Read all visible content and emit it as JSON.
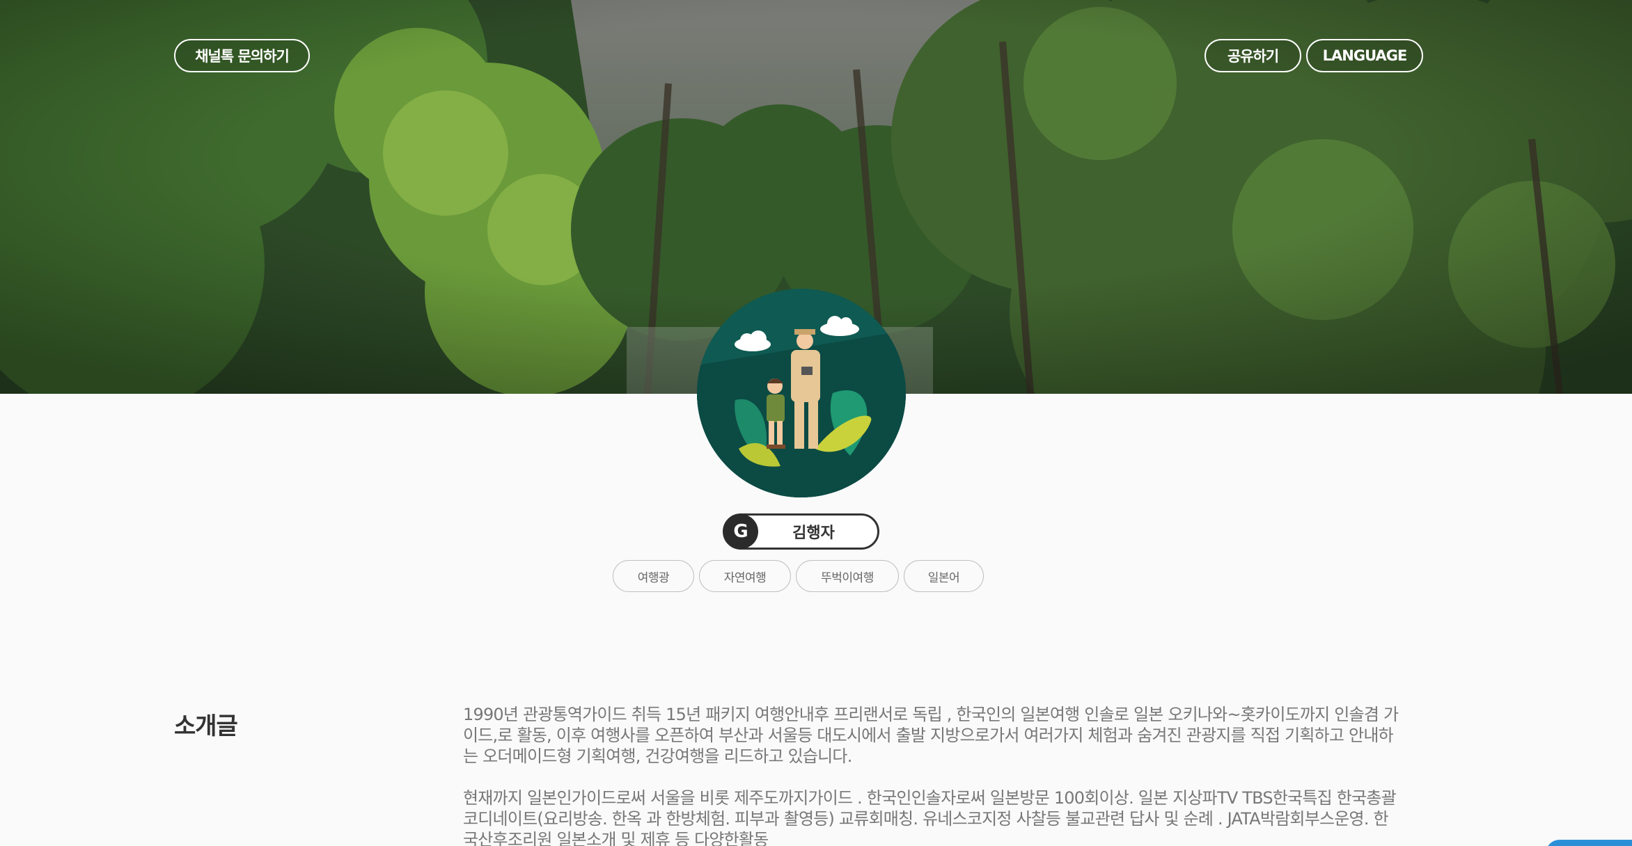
{
  "header": {
    "kakao_button": "채널톡 문의하기",
    "share_button": "공유하기",
    "language_button": "LANGUAGE"
  },
  "profile": {
    "badge_letter": "G",
    "name": "김행자",
    "tags": [
      "여행광",
      "자연여행",
      "뚜벅이여행",
      "일본어"
    ]
  },
  "intro": {
    "title": "소개글",
    "paragraphs": [
      "1990년 관광통역가이드 취득 15년 패키지 여행안내후 프리랜서로 독립 , 한국인의 일본여행 인솔로 일본 오키나와~홋카이도까지 인솔겸 가이드,로 활동, 이후 여행사를 오픈하여 부산과 서울등 대도시에서 출발 지방으로가서 여러가지 체험과 숨겨진 관광지를 직접 기획하고 안내하는 오더메이드형 기획여행, 건강여행을 리드하고 있습니다.",
      "현재까지 일본인가이드로써 서울을 비롯 제주도까지가이드 . 한국인인솔자로써 일본방문 100회이상. 일본 지상파TV TBS한국특집 한국총괄코디네이트(요리방송. 한옥 과 한방체험. 피부과 촬영등) 교류회매칭. 유네스코지정 사찰등 불교관련 답사 및 순례 . JATA박람회부스운영. 한국산후조리원 일본소개 및 제휴 등 다양한활동"
    ]
  },
  "colors": {
    "accent": "#2b8fd8",
    "avatar_bg": "#0f5a52"
  }
}
